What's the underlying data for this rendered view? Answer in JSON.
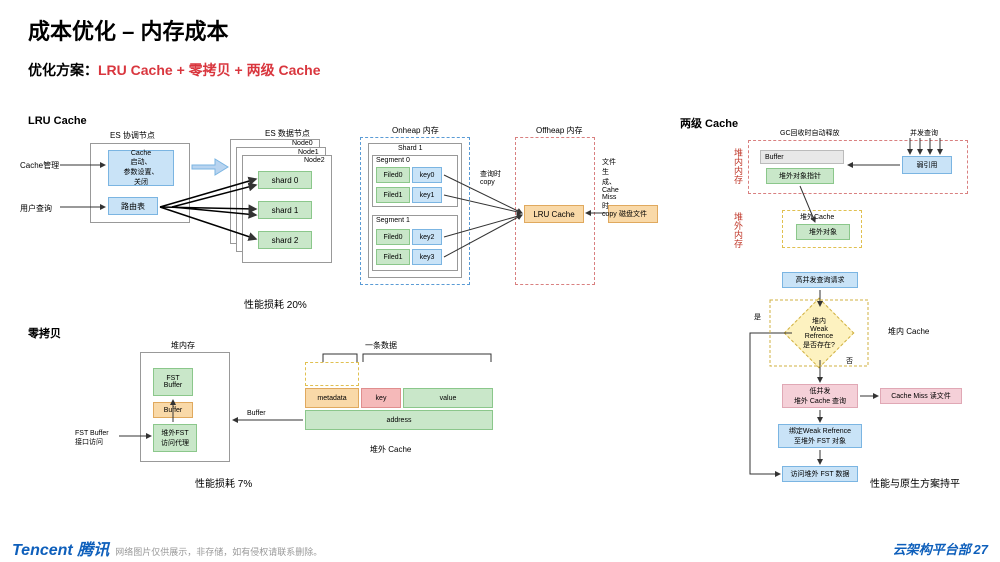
{
  "title": "成本优化 – 内存成本",
  "subtitle_prefix": "优化方案：",
  "subtitle_red": "LRU Cache + 零拷贝 + 两级 Cache",
  "sections": {
    "lru": "LRU Cache",
    "zero_copy": "零拷贝",
    "two_level": "两级 Cache"
  },
  "lru": {
    "coord_node": "ES 协调节点",
    "data_node": "ES 数据节点",
    "cache_mgmt": "Cache管理",
    "user_query": "用户查询",
    "cache_box": "Cache\n启动、\n参数设置、\n关闭",
    "route": "路由表",
    "node0": "Node0",
    "node1": "Node1",
    "node2": "Node2",
    "shard0": "shard 0",
    "shard1": "shard 1",
    "shard2": "shard 2",
    "onheap": "Onheap 内存",
    "offheap": "Offheap 内存",
    "shard1_box": "Shard 1",
    "seg0": "Segment 0",
    "seg1": "Segment 1",
    "filed0": "Filed0",
    "filed1": "Filed1",
    "key0": "key0",
    "key1": "key1",
    "key2": "key2",
    "key3": "key3",
    "query_copy": "查询时\ncopy",
    "lru_cache_box": "LRU Cache",
    "file_gen": "文件生成、\nCahe Miss 时\ncopy",
    "disk_file": "磁盘文件",
    "perf": "性能损耗 20%"
  },
  "zero_copy": {
    "heap_in": "堆内存",
    "fst_buffer": "FST\nBuffer",
    "buffer": "Buffer",
    "fst_proxy": "堆外FST\n访问代理",
    "fst_access": "FST Buffer\n接口访问",
    "buffer_arrow": "Buffer",
    "one_record": "一条数据",
    "metadata": "metadata",
    "key": "key",
    "value": "value",
    "address": "address",
    "heap_out": "堆外 Cache",
    "perf": "性能损耗 7%"
  },
  "two_level": {
    "gc_release": "GC回收时自动释放",
    "concurrent_query": "并发查询",
    "buffer": "Buffer",
    "heap_out_ptr": "堆外对象指针",
    "weak_ref": "弱引用",
    "heap_in_label": "堆内内存",
    "heap_out_label": "堆外内存",
    "heap_out_cache": "堆外Cache",
    "heap_out_obj": "堆外对象",
    "high_concurrent": "高并发查询请求",
    "diamond": "堆内\nWeak Refrence\n是否存在?",
    "heap_in_cache": "堆内 Cache",
    "yes": "是",
    "no": "否",
    "low_concurrent": "低并发\n堆外 Cache 查询",
    "cache_miss": "Cache Miss 读文件",
    "bind_weak": "绑定Weak Refrence\n至堆外 FST 对象",
    "access_fst": "访问堆外 FST 数据",
    "perf": "性能与原生方案持平"
  },
  "footer": {
    "tencent": "Tencent 腾讯",
    "note": "网络图片仅供展示，非存储，如有侵权请联系删除。",
    "brand": "云架构平台部",
    "page": "27"
  }
}
